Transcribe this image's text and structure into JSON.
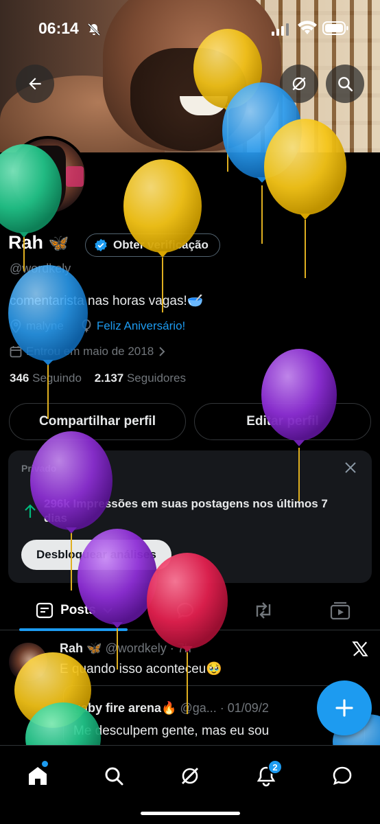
{
  "status_bar": {
    "time": "06:14"
  },
  "profile": {
    "name": "Rah",
    "name_emoji": "🦋",
    "verify_label": "Obter verificação",
    "handle": "@wordkely",
    "bio": "comentarista nas horas vagas!🥣",
    "location": "malyne",
    "birthday_link": "Feliz Aniversário!",
    "joined": "Entrou em maio de 2018",
    "following_count": "346",
    "following_label": "Seguindo",
    "followers_count": "2.137",
    "followers_label": "Seguidores"
  },
  "actions": {
    "share": "Compartilhar perfil",
    "edit": "Editar perfil"
  },
  "insights_card": {
    "label": "Privado",
    "impressions": "296k Impressões em suas postagens nos últimos 7 dias",
    "unlock": "Desbloquear análises"
  },
  "tabs": {
    "posts": "Posts"
  },
  "post": {
    "author": "Rah",
    "author_emoji": "🦋",
    "handle": "@wordkely",
    "time": "· 7h",
    "text": "E quando isso aconteceu🥹",
    "quote_author": "gaby fire arena🔥",
    "quote_handle": "@ga... · 01/09/2",
    "quote_text": "Me desculpem gente, mas eu sou"
  },
  "bottom_nav": {
    "notifications_badge": "2"
  },
  "colors": {
    "accent": "#1d9bf0",
    "background": "#000000",
    "muted": "#71767b"
  }
}
